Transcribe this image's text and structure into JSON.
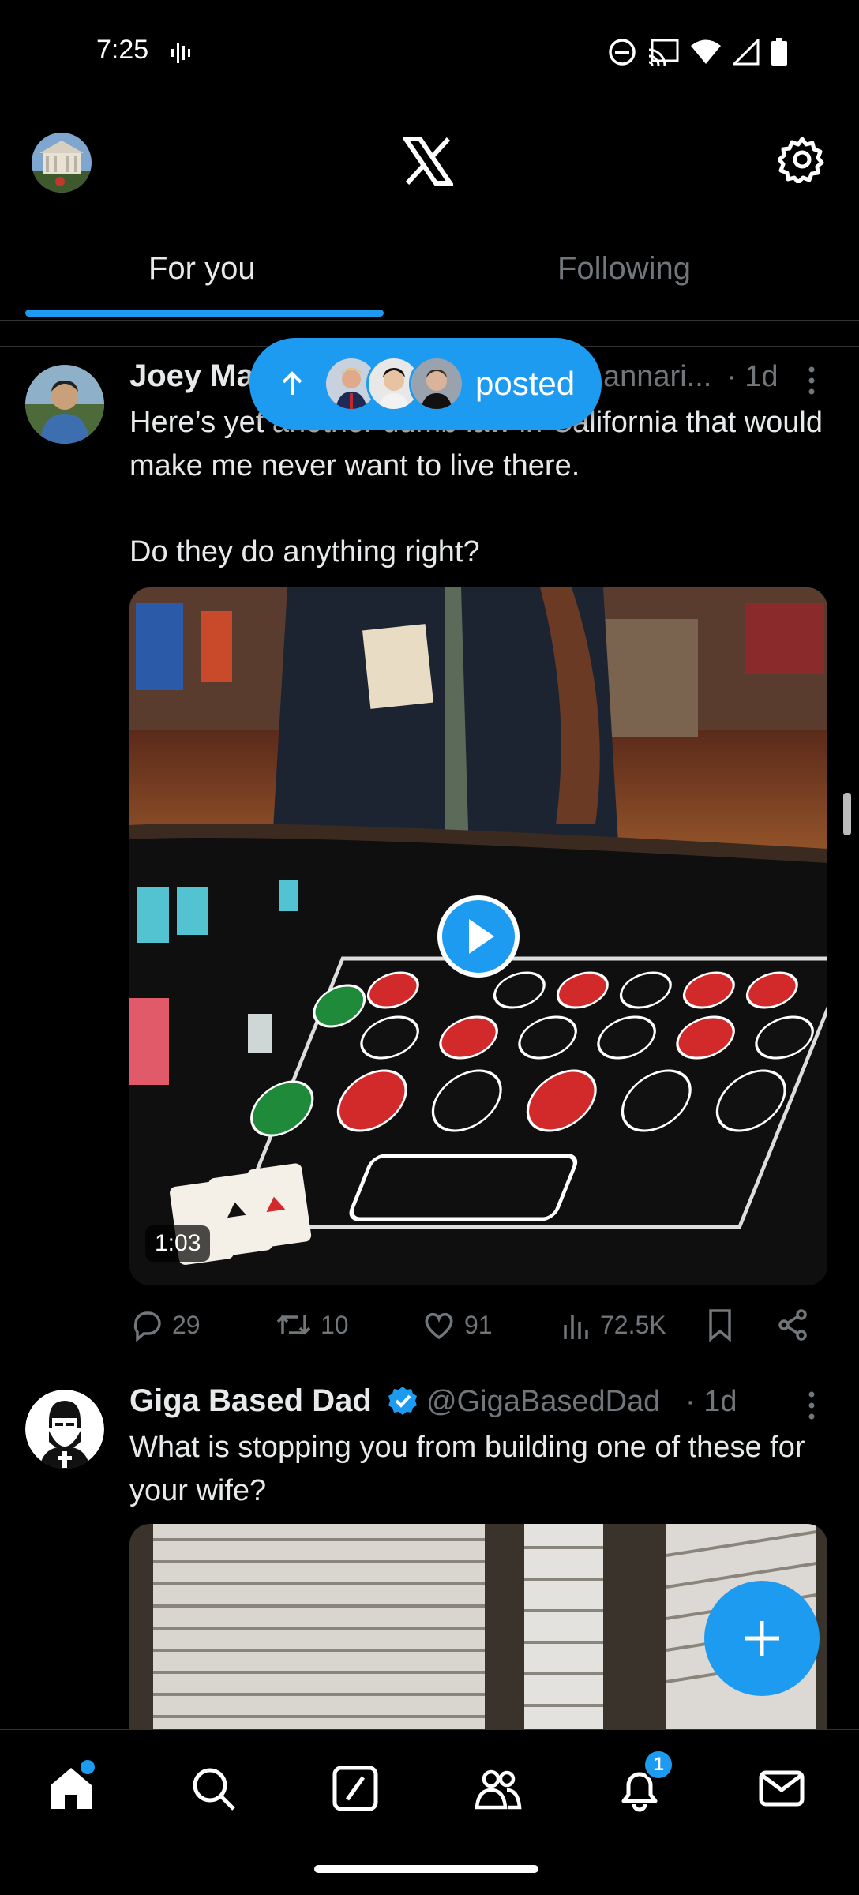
{
  "status_bar": {
    "time": "7:25"
  },
  "tabs": {
    "for_you": "For you",
    "following": "Following"
  },
  "pill": {
    "label": "posted"
  },
  "tweets": [
    {
      "name": "Joey Ma",
      "handle": "annari...",
      "time": "· 1d",
      "text_1": "Here’s yet another dumb law in California that would make me never want to live there.",
      "text_2": "Do they do anything right?",
      "video_duration": "1:03",
      "replies": "29",
      "reposts": "10",
      "likes": "91",
      "views": "72.5K"
    },
    {
      "name": "Giga Based Dad",
      "handle": "@GigaBasedDad",
      "time": "· 1d",
      "text_1": "What is stopping you from building one of these for your wife?"
    }
  ],
  "nav": {
    "notifications_badge": "1"
  },
  "colors": {
    "accent": "#1d9bf0",
    "background": "#000000",
    "muted": "#71767b",
    "text": "#e7e9ea"
  }
}
